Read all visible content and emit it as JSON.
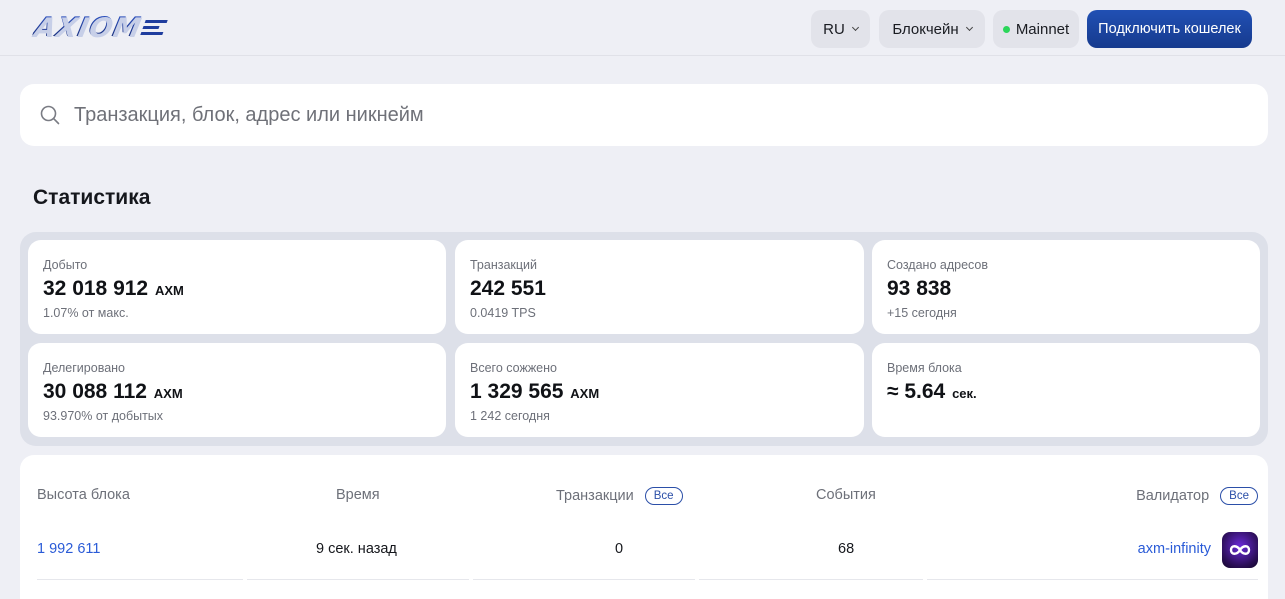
{
  "header": {
    "logo_text": "AXIOM",
    "language": "RU",
    "blockchain_menu": "Блокчейн",
    "network": "Mainnet",
    "connect_wallet": "Подключить кошелек"
  },
  "search": {
    "placeholder": "Транзакция, блок, адрес или никнейм"
  },
  "stats": {
    "title": "Статистика",
    "cards": [
      {
        "label": "Добыто",
        "value": "32 018 912",
        "unit": "AXM",
        "sub": "1.07% от макс."
      },
      {
        "label": "Транзакций",
        "value": "242 551",
        "unit": "",
        "sub": "0.0419 TPS"
      },
      {
        "label": "Создано адресов",
        "value": "93 838",
        "unit": "",
        "sub": "+15 сегодня"
      },
      {
        "label": "Делегировано",
        "value": "30 088 112",
        "unit": "AXM",
        "sub": "93.970% от добытых"
      },
      {
        "label": "Всего сожжено",
        "value": "1 329 565",
        "unit": "AXM",
        "sub": "1 242 сегодня"
      },
      {
        "label": "Время блока",
        "value": "≈ 5.64",
        "unit": "сек.",
        "sub": ""
      }
    ]
  },
  "blocks": {
    "headers": {
      "height": "Высота блока",
      "time": "Время",
      "transactions": "Транзакции",
      "events": "События",
      "validator": "Валидатор",
      "all_label": "Все"
    },
    "rows": [
      {
        "height": "1 992 611",
        "time": "9 сек. назад",
        "transactions": "0",
        "events": "68",
        "validator": "axm-infinity"
      }
    ]
  },
  "colors": {
    "accent": "#1d4aa8",
    "link": "#2a5bd7",
    "online": "#2bd65a"
  }
}
